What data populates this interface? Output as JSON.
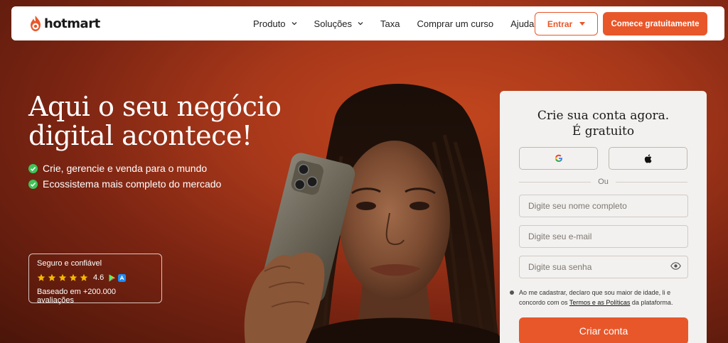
{
  "nav": {
    "logo_text": "hotmart",
    "menu": [
      {
        "label": "Produto",
        "dropdown": true
      },
      {
        "label": "Soluções",
        "dropdown": true
      },
      {
        "label": "Taxa",
        "dropdown": false
      },
      {
        "label": "Comprar um curso",
        "dropdown": false
      },
      {
        "label": "Ajuda",
        "dropdown": false
      }
    ],
    "login_label": "Entrar",
    "cta_label": "Comece gratuitamente"
  },
  "hero": {
    "title_line1": "Aqui o seu negócio",
    "title_line2": "digital acontece!",
    "bullets": [
      "Crie, gerencie e venda para o mundo",
      "Ecossistema mais completo do mercado"
    ]
  },
  "trust": {
    "title": "Seguro e confiável",
    "rating": "4.6",
    "stars": 5,
    "reviews": "Baseado em +200.000 avaliações"
  },
  "signup": {
    "title_line1": "Crie sua conta agora.",
    "title_line2": "É gratuito",
    "divider_text": "Ou",
    "name_placeholder": "Digite seu nome completo",
    "email_placeholder": "Digite seu e-mail",
    "password_placeholder": "Digite sua senha",
    "terms_before": "Ao me cadastrar, declaro que sou maior de idade, li e concordo com os ",
    "terms_link": "Termos e as Políticas",
    "terms_after": " da plataforma.",
    "submit_label": "Criar conta"
  },
  "colors": {
    "brand": "#e8572a",
    "background": "#a8381a",
    "check": "#3fc35a",
    "star": "#f5b800"
  }
}
